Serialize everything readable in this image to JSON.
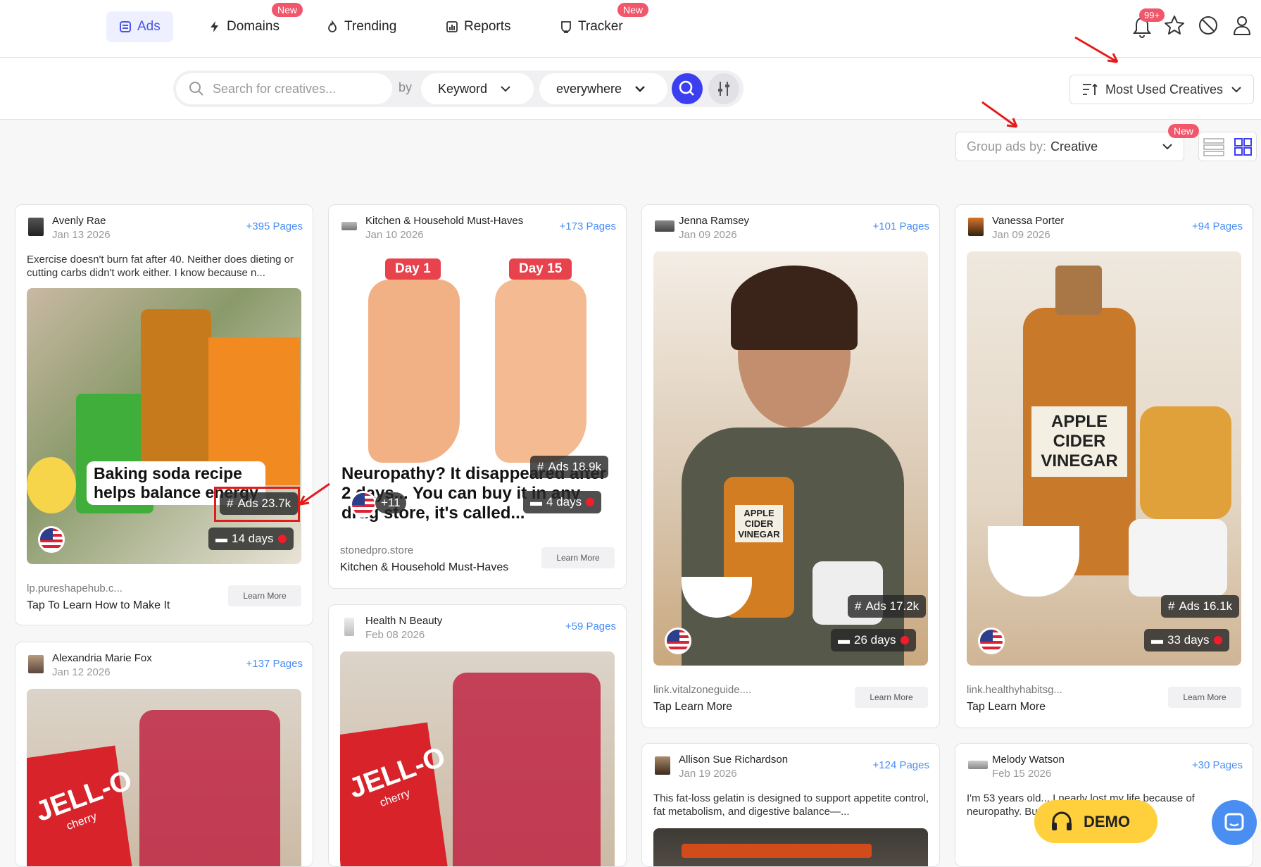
{
  "nav": {
    "tabs": [
      {
        "label": "Ads",
        "icon": "ads-icon",
        "active": true
      },
      {
        "label": "Domains",
        "icon": "bolt-icon",
        "badge": "New"
      },
      {
        "label": "Trending",
        "icon": "fire-icon"
      },
      {
        "label": "Reports",
        "icon": "report-icon"
      },
      {
        "label": "Tracker",
        "icon": "tracker-icon",
        "badge": "New"
      }
    ],
    "notifications_badge": "99+"
  },
  "search": {
    "placeholder": "Search for creatives...",
    "by_label": "by",
    "type_value": "Keyword",
    "scope_value": "everywhere"
  },
  "sort": {
    "value": "Most Used Creatives"
  },
  "group": {
    "label": "Group ads by:",
    "value": "Creative",
    "badge": "New"
  },
  "cards": [
    {
      "advertiser": "Avenly Rae",
      "date": "Jan 13 2026",
      "pages": "+395 Pages",
      "text": "Exercise doesn't burn fat after 40. Neither does dieting or cutting carbs didn't work either. I know because n...",
      "ads": "Ads 23.7k",
      "days": "14 days",
      "media_caption_1": "Baking soda recipe",
      "media_caption_2": "helps balance energy",
      "domain": "lp.pureshapehub.c...",
      "cta": "Tap To Learn How to Make It",
      "button": "Learn More"
    },
    {
      "advertiser": "Kitchen & Household Must-Haves",
      "date": "Jan 10 2026",
      "pages": "+173 Pages",
      "ads": "Ads 18.9k",
      "days": "4 days",
      "extra_flags": "+11",
      "day_label_1": "Day 1",
      "day_label_2": "Day 15",
      "media_caption": "Neuropathy? It disappeared after 2 days... You can buy it in any drug store, it's called...",
      "domain": "stonedpro.store",
      "cta": "Kitchen & Household Must-Haves",
      "button": "Learn More"
    },
    {
      "advertiser": "Jenna Ramsey",
      "date": "Jan 09 2026",
      "pages": "+101 Pages",
      "ads": "Ads 17.2k",
      "days": "26 days",
      "jar_label": "APPLE CIDER VINEGAR",
      "domain": "link.vitalzoneguide....",
      "cta": "Tap Learn More",
      "button": "Learn More"
    },
    {
      "advertiser": "Vanessa Porter",
      "date": "Jan 09 2026",
      "pages": "+94 Pages",
      "ads": "Ads 16.1k",
      "days": "33 days",
      "jar_label": "APPLE CIDER VINEGAR",
      "domain": "link.healthyhabitsg...",
      "cta": "Tap Learn More",
      "button": "Learn More"
    },
    {
      "advertiser": "Alexandria Marie Fox",
      "date": "Jan 12 2026",
      "pages": "+137 Pages",
      "box_label": "JELL-O",
      "box_sublabel": "cherry"
    },
    {
      "advertiser": "Health N Beauty",
      "date": "Feb 08 2026",
      "pages": "+59 Pages",
      "box_label": "JELL-O",
      "box_sublabel": "cherry"
    },
    {
      "advertiser": "Allison Sue Richardson",
      "date": "Jan 19 2026",
      "pages": "+124 Pages",
      "text": "This fat-loss gelatin is designed to support appetite control, fat metabolism, and digestive balance—..."
    },
    {
      "advertiser": "Melody Watson",
      "date": "Feb 15 2026",
      "pages": "+30 Pages",
      "text": "I'm 53 years old... I nearly lost my life because of neuropathy. But just one pi...rything"
    }
  ],
  "demo": {
    "label": "DEMO"
  },
  "colors": {
    "accent": "#3b3ff0",
    "badge": "#f2566b",
    "link": "#4a8ef2",
    "demo": "#ffcf3c"
  }
}
